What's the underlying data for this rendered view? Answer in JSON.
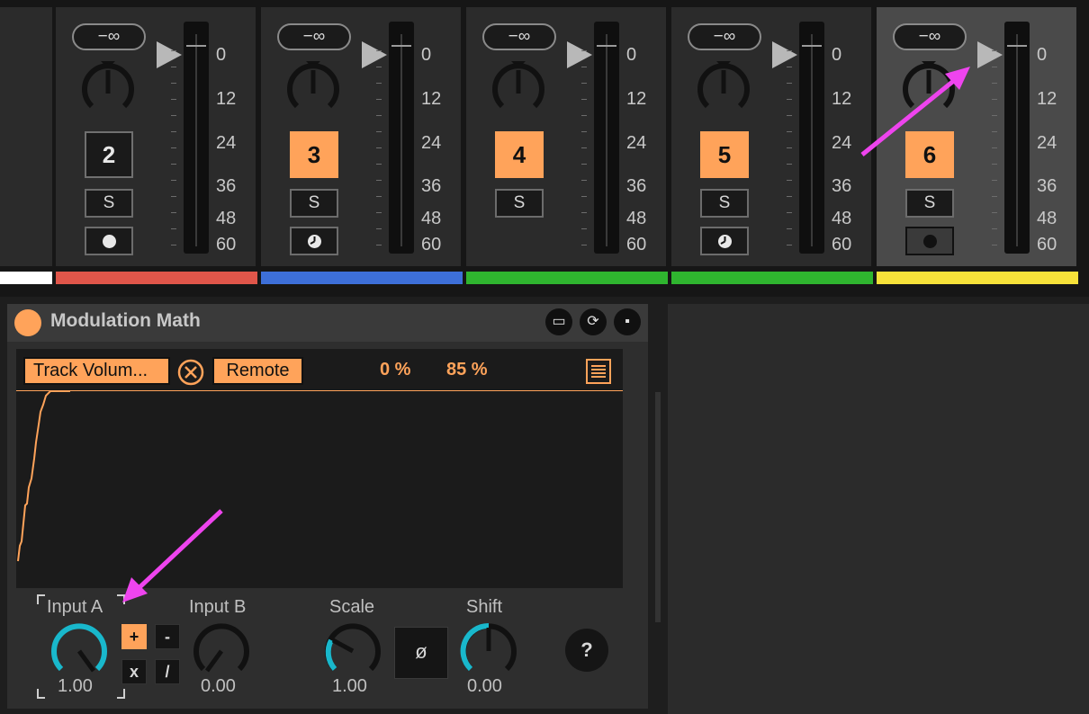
{
  "mixer": {
    "scale_labels": [
      "0",
      "12",
      "24",
      "36",
      "48",
      "60"
    ],
    "tracks": [
      {
        "number": "2",
        "volume": "−∞",
        "solo": "S",
        "active": false,
        "selected": false,
        "arm_icon": "dot-icon",
        "color": "#e0564a"
      },
      {
        "number": "3",
        "volume": "−∞",
        "solo": "S",
        "active": true,
        "selected": false,
        "arm_icon": "half-dot-icon",
        "color": "#3d6fd8"
      },
      {
        "number": "4",
        "volume": "−∞",
        "solo": "S",
        "active": true,
        "selected": false,
        "arm_icon": "none",
        "color": "#2fb52f"
      },
      {
        "number": "5",
        "volume": "−∞",
        "solo": "S",
        "active": true,
        "selected": false,
        "arm_icon": "half-dot-icon",
        "color": "#2fb52f"
      },
      {
        "number": "6",
        "volume": "−∞",
        "solo": "S",
        "active": true,
        "selected": true,
        "arm_icon": "record-dot-icon",
        "color": "#f7e23a"
      }
    ]
  },
  "device": {
    "title": "Modulation Math",
    "target_button": "Track Volum...",
    "remote_button": "Remote",
    "min_percent": "0 %",
    "max_percent": "85 %",
    "input_a": {
      "label": "Input A",
      "value": "1.00"
    },
    "input_b": {
      "label": "Input B",
      "value": "0.00"
    },
    "scale": {
      "label": "Scale",
      "value": "1.00"
    },
    "shift": {
      "label": "Shift",
      "value": "0.00"
    },
    "operators": [
      "+",
      "-",
      "x",
      "/"
    ],
    "active_operator": "+",
    "invert_button": "ø",
    "help_button": "?"
  },
  "colors": {
    "accent": "#ffa35a",
    "knob_arc": "#19b8cc",
    "annotation_arrow": "#ee44ee"
  }
}
